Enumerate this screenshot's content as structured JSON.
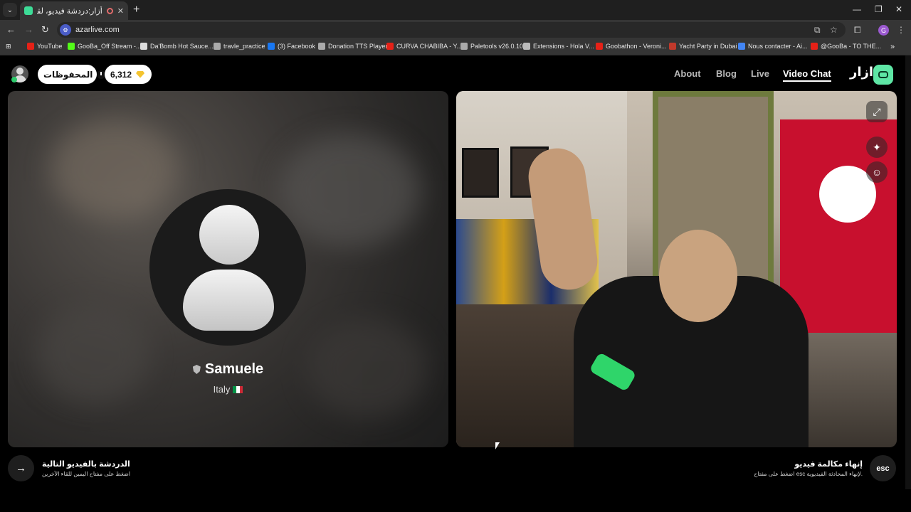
{
  "browser": {
    "tab_title": "أزار:دردشة فيديو، لقاء الأصدقا",
    "url": "azarlive.com",
    "bookmarks": [
      {
        "label": "YouTube",
        "color": "#e62117"
      },
      {
        "label": "GooBa_Off Stream -...",
        "color": "#53fc18"
      },
      {
        "label": "Da'Bomb Hot Sauce...",
        "color": "#dddddd"
      },
      {
        "label": "travle_practice",
        "color": "#aaaaaa"
      },
      {
        "label": "(3) Facebook",
        "color": "#1877f2"
      },
      {
        "label": "Donation TTS Player",
        "color": "#aaaaaa"
      },
      {
        "label": "CURVA CHABIBA - Y...",
        "color": "#e62117"
      },
      {
        "label": "Paletools v26.0.10",
        "color": "#aaaaaa"
      },
      {
        "label": "Extensions - Hola V...",
        "color": "#bbbbbb"
      },
      {
        "label": "Goobathon - Veroni...",
        "color": "#e62117"
      },
      {
        "label": "Yacht Party in Dubai",
        "color": "#c0392b"
      },
      {
        "label": "Nous contacter - Ai...",
        "color": "#4285f4"
      },
      {
        "label": "@GooBa - TO THE...",
        "color": "#e62117"
      }
    ]
  },
  "header": {
    "saved_label": "المحفوظات",
    "gems_count": "6,312",
    "nav": [
      "About",
      "Blog",
      "Live",
      "Video Chat"
    ],
    "brand": "ازار"
  },
  "remote": {
    "name": "Samuele",
    "country": "Italy"
  },
  "footer": {
    "next_title": "الدردشة بالفيديو التالية",
    "next_sub": "اضغط على مفتاح اليمين للقاء الآخرين",
    "end_title": "إنهاء مكالمة فيديو",
    "end_sub": "اضغط على مفتاح esc لإنهاء المحادثة الفيديوية.",
    "esc_label": "esc"
  },
  "colors": {
    "brand_green": "#5ee6a5",
    "gem_gold": "#f4c430"
  }
}
